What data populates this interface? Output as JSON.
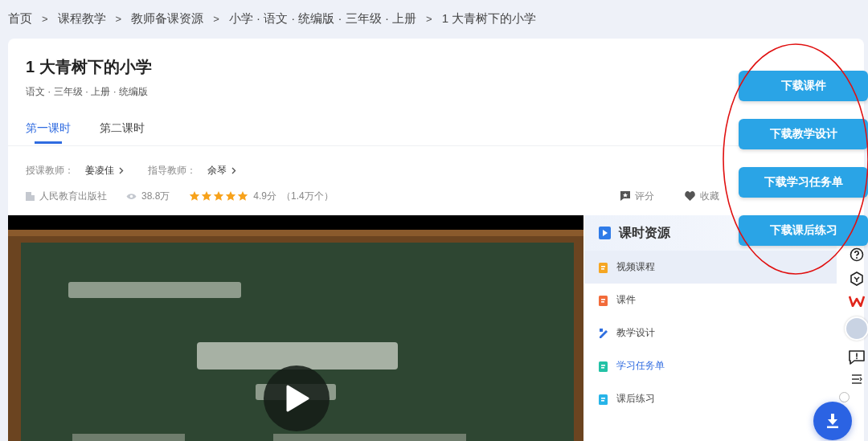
{
  "breadcrumb": {
    "separator": ">",
    "items": [
      "首页",
      "课程教学",
      "教师备课资源",
      "小学 · 语文 · 统编版 · 三年级 · 上册",
      "1 大青树下的小学"
    ]
  },
  "lesson": {
    "title": "1 大青树下的小学",
    "meta": "语文 · 三年级 · 上册 · 统编版"
  },
  "tabs": [
    {
      "label": "第一课时",
      "selected": true
    },
    {
      "label": "第二课时",
      "selected": false
    }
  ],
  "teachers": [
    {
      "label": "授课教师：",
      "name": "姜凌佳"
    },
    {
      "label": "指导教师：",
      "name": "余琴"
    }
  ],
  "stats": {
    "publisher": "人民教育出版社",
    "views": "38.8万",
    "stars": 5,
    "rating": "4.9分",
    "rating_count": "（1.4万个）"
  },
  "actions": [
    {
      "kind": "rate",
      "label": "评分"
    },
    {
      "kind": "favorite",
      "label": "收藏"
    }
  ],
  "video": {
    "kind": "picture"
  },
  "resources": {
    "title": "课时资源",
    "items": [
      {
        "kind": "video",
        "label": "视频课程",
        "selected": true,
        "hovered": false
      },
      {
        "kind": "slides",
        "label": "课件",
        "selected": false,
        "hovered": false
      },
      {
        "kind": "design",
        "label": "教学设计",
        "selected": false,
        "hovered": false
      },
      {
        "kind": "tasks",
        "label": "学习任务单",
        "selected": false,
        "hovered": true
      },
      {
        "kind": "exercise",
        "label": "课后练习",
        "selected": false,
        "hovered": false
      }
    ]
  },
  "download_buttons": [
    "下载课件",
    "下载教学设计",
    "下载学习任务单",
    "下载课后练习"
  ]
}
